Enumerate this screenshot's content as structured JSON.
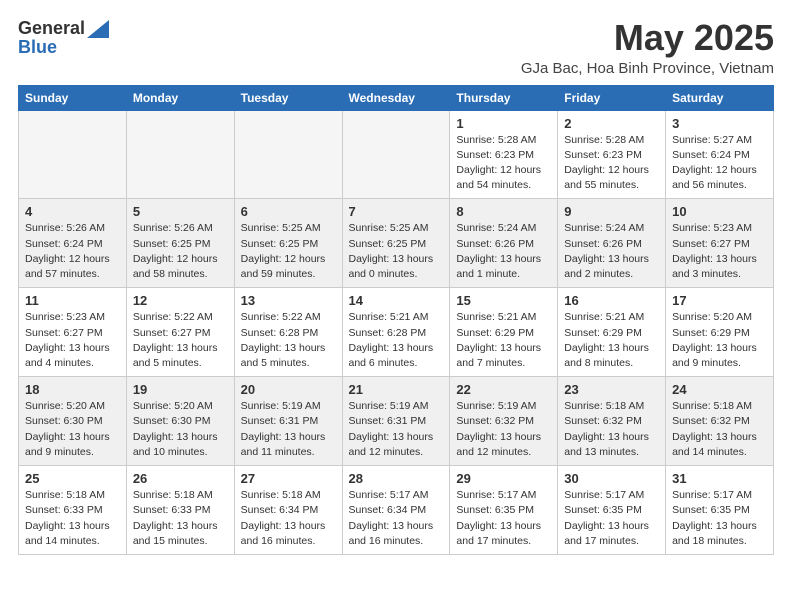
{
  "logo": {
    "general": "General",
    "blue": "Blue",
    "tagline": ""
  },
  "title": "May 2025",
  "subtitle": "GJa Bac, Hoa Binh Province, Vietnam",
  "days_of_week": [
    "Sunday",
    "Monday",
    "Tuesday",
    "Wednesday",
    "Thursday",
    "Friday",
    "Saturday"
  ],
  "weeks": [
    [
      {
        "day": "",
        "info": ""
      },
      {
        "day": "",
        "info": ""
      },
      {
        "day": "",
        "info": ""
      },
      {
        "day": "",
        "info": ""
      },
      {
        "day": "1",
        "info": "Sunrise: 5:28 AM\nSunset: 6:23 PM\nDaylight: 12 hours\nand 54 minutes."
      },
      {
        "day": "2",
        "info": "Sunrise: 5:28 AM\nSunset: 6:23 PM\nDaylight: 12 hours\nand 55 minutes."
      },
      {
        "day": "3",
        "info": "Sunrise: 5:27 AM\nSunset: 6:24 PM\nDaylight: 12 hours\nand 56 minutes."
      }
    ],
    [
      {
        "day": "4",
        "info": "Sunrise: 5:26 AM\nSunset: 6:24 PM\nDaylight: 12 hours\nand 57 minutes."
      },
      {
        "day": "5",
        "info": "Sunrise: 5:26 AM\nSunset: 6:25 PM\nDaylight: 12 hours\nand 58 minutes."
      },
      {
        "day": "6",
        "info": "Sunrise: 5:25 AM\nSunset: 6:25 PM\nDaylight: 12 hours\nand 59 minutes."
      },
      {
        "day": "7",
        "info": "Sunrise: 5:25 AM\nSunset: 6:25 PM\nDaylight: 13 hours\nand 0 minutes."
      },
      {
        "day": "8",
        "info": "Sunrise: 5:24 AM\nSunset: 6:26 PM\nDaylight: 13 hours\nand 1 minute."
      },
      {
        "day": "9",
        "info": "Sunrise: 5:24 AM\nSunset: 6:26 PM\nDaylight: 13 hours\nand 2 minutes."
      },
      {
        "day": "10",
        "info": "Sunrise: 5:23 AM\nSunset: 6:27 PM\nDaylight: 13 hours\nand 3 minutes."
      }
    ],
    [
      {
        "day": "11",
        "info": "Sunrise: 5:23 AM\nSunset: 6:27 PM\nDaylight: 13 hours\nand 4 minutes."
      },
      {
        "day": "12",
        "info": "Sunrise: 5:22 AM\nSunset: 6:27 PM\nDaylight: 13 hours\nand 5 minutes."
      },
      {
        "day": "13",
        "info": "Sunrise: 5:22 AM\nSunset: 6:28 PM\nDaylight: 13 hours\nand 5 minutes."
      },
      {
        "day": "14",
        "info": "Sunrise: 5:21 AM\nSunset: 6:28 PM\nDaylight: 13 hours\nand 6 minutes."
      },
      {
        "day": "15",
        "info": "Sunrise: 5:21 AM\nSunset: 6:29 PM\nDaylight: 13 hours\nand 7 minutes."
      },
      {
        "day": "16",
        "info": "Sunrise: 5:21 AM\nSunset: 6:29 PM\nDaylight: 13 hours\nand 8 minutes."
      },
      {
        "day": "17",
        "info": "Sunrise: 5:20 AM\nSunset: 6:29 PM\nDaylight: 13 hours\nand 9 minutes."
      }
    ],
    [
      {
        "day": "18",
        "info": "Sunrise: 5:20 AM\nSunset: 6:30 PM\nDaylight: 13 hours\nand 9 minutes."
      },
      {
        "day": "19",
        "info": "Sunrise: 5:20 AM\nSunset: 6:30 PM\nDaylight: 13 hours\nand 10 minutes."
      },
      {
        "day": "20",
        "info": "Sunrise: 5:19 AM\nSunset: 6:31 PM\nDaylight: 13 hours\nand 11 minutes."
      },
      {
        "day": "21",
        "info": "Sunrise: 5:19 AM\nSunset: 6:31 PM\nDaylight: 13 hours\nand 12 minutes."
      },
      {
        "day": "22",
        "info": "Sunrise: 5:19 AM\nSunset: 6:32 PM\nDaylight: 13 hours\nand 12 minutes."
      },
      {
        "day": "23",
        "info": "Sunrise: 5:18 AM\nSunset: 6:32 PM\nDaylight: 13 hours\nand 13 minutes."
      },
      {
        "day": "24",
        "info": "Sunrise: 5:18 AM\nSunset: 6:32 PM\nDaylight: 13 hours\nand 14 minutes."
      }
    ],
    [
      {
        "day": "25",
        "info": "Sunrise: 5:18 AM\nSunset: 6:33 PM\nDaylight: 13 hours\nand 14 minutes."
      },
      {
        "day": "26",
        "info": "Sunrise: 5:18 AM\nSunset: 6:33 PM\nDaylight: 13 hours\nand 15 minutes."
      },
      {
        "day": "27",
        "info": "Sunrise: 5:18 AM\nSunset: 6:34 PM\nDaylight: 13 hours\nand 16 minutes."
      },
      {
        "day": "28",
        "info": "Sunrise: 5:17 AM\nSunset: 6:34 PM\nDaylight: 13 hours\nand 16 minutes."
      },
      {
        "day": "29",
        "info": "Sunrise: 5:17 AM\nSunset: 6:35 PM\nDaylight: 13 hours\nand 17 minutes."
      },
      {
        "day": "30",
        "info": "Sunrise: 5:17 AM\nSunset: 6:35 PM\nDaylight: 13 hours\nand 17 minutes."
      },
      {
        "day": "31",
        "info": "Sunrise: 5:17 AM\nSunset: 6:35 PM\nDaylight: 13 hours\nand 18 minutes."
      }
    ]
  ]
}
